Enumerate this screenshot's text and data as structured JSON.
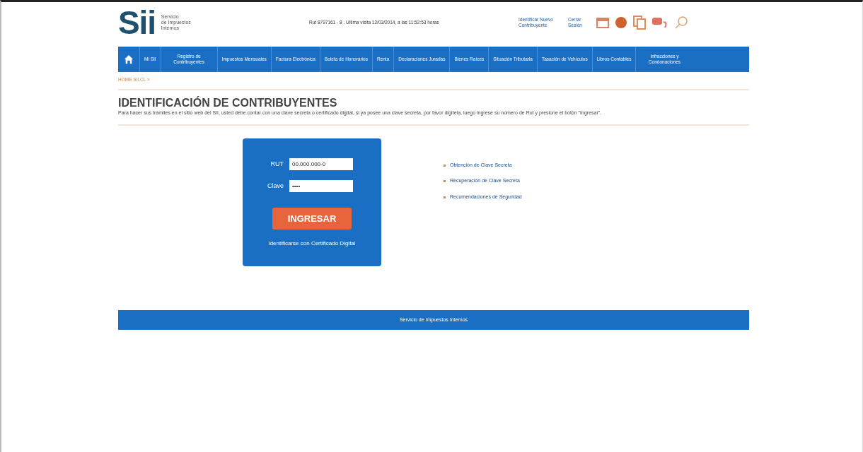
{
  "header": {
    "logo_letters": "Sii",
    "logo_text": [
      "Servicio",
      "de Impuestos",
      "Internos"
    ],
    "user_info": "Rut 8797161 - 8 . Ultima visita 12/03/2014, a las 11:52:53 horas",
    "links": [
      "Identificar Nuevo Contribuyente",
      "Cerrar Sesión"
    ]
  },
  "nav": {
    "items": [
      {
        "kind": "home"
      },
      {
        "kind": "text",
        "label": "Mi SII"
      },
      {
        "kind": "text",
        "label": "Registro de Contribuyentes"
      },
      {
        "kind": "text",
        "label": "Impuestos Mensuales"
      },
      {
        "kind": "text",
        "label": "Factura Electrónica"
      },
      {
        "kind": "text",
        "label": "Boleta de Honorarios"
      },
      {
        "kind": "text",
        "label": "Renta"
      },
      {
        "kind": "text",
        "label": "Declaraciones Juradas"
      },
      {
        "kind": "text",
        "label": "Bienes Raíces"
      },
      {
        "kind": "text",
        "label": "Situación Tributaria"
      },
      {
        "kind": "text",
        "label": "Tasación de Vehículos"
      },
      {
        "kind": "text",
        "label": "Libros Contables"
      },
      {
        "kind": "text",
        "label": "Infracciones y Condonaciones"
      }
    ]
  },
  "breadcrumb": "HOME SII.CL »",
  "title": "IDENTIFICACIÓN DE CONTRIBUYENTES",
  "intro": "Para hacer sus trámites en el sitio web del SII, usted debe contar con una clave secreta o certificado digital, si ya posee una clave secreta, por favor digítela, luego ingrese su número de Rut y presione el botón \"Ingresar\".",
  "login": {
    "rut_label": "RUT",
    "rut_value": "00.000.000-0",
    "clave_label": "Clave",
    "clave_value": "••••",
    "button": "INGRESAR",
    "certificate_link": "Identificarse con Certificado Digital"
  },
  "help_links": [
    "Obtención de Clave Secreta",
    "Recuperación de Clave Secreta",
    "Recomendaciones de Seguridad"
  ],
  "footer": "Servicio de Impuestos Internos"
}
